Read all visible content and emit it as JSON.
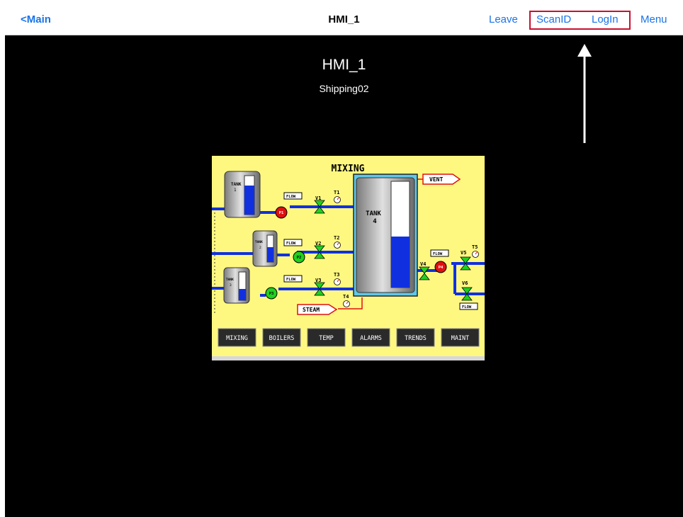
{
  "nav": {
    "back_label": "<Main",
    "title": "HMI_1",
    "leave_label": "Leave",
    "scanid_label": "ScanID",
    "login_label": "LogIn",
    "menu_label": "Menu",
    "link_color": "#1a73e8",
    "highlight_color": "#c8102e"
  },
  "header": {
    "title": "HMI_1",
    "subtitle": "Shipping02"
  },
  "hmi": {
    "title": "MIXING",
    "background": "#fff880",
    "tanks": [
      {
        "label": "TANK",
        "number": "1",
        "level": 0.75
      },
      {
        "label": "TANK",
        "number": "2",
        "level": 0.55
      },
      {
        "label": "TANK",
        "number": "3",
        "level": 0.4
      },
      {
        "label": "TANK",
        "number": "4",
        "level": 0.48
      }
    ],
    "pumps": [
      {
        "label": "P1",
        "state": "red"
      },
      {
        "label": "P2",
        "state": "green"
      },
      {
        "label": "P3",
        "state": "green"
      },
      {
        "label": "P4",
        "state": "red"
      }
    ],
    "valves": [
      "V1",
      "V2",
      "V3",
      "V4",
      "V5",
      "V6"
    ],
    "thermometers": [
      "T1",
      "T2",
      "T3",
      "T4",
      "T5"
    ],
    "flow_label": "FLOW",
    "vent_label": "VENT",
    "steam_label": "STEAM",
    "buttons": [
      "MIXING",
      "BOILERS",
      "TEMP",
      "ALARMS",
      "TRENDS",
      "MAINT"
    ]
  }
}
